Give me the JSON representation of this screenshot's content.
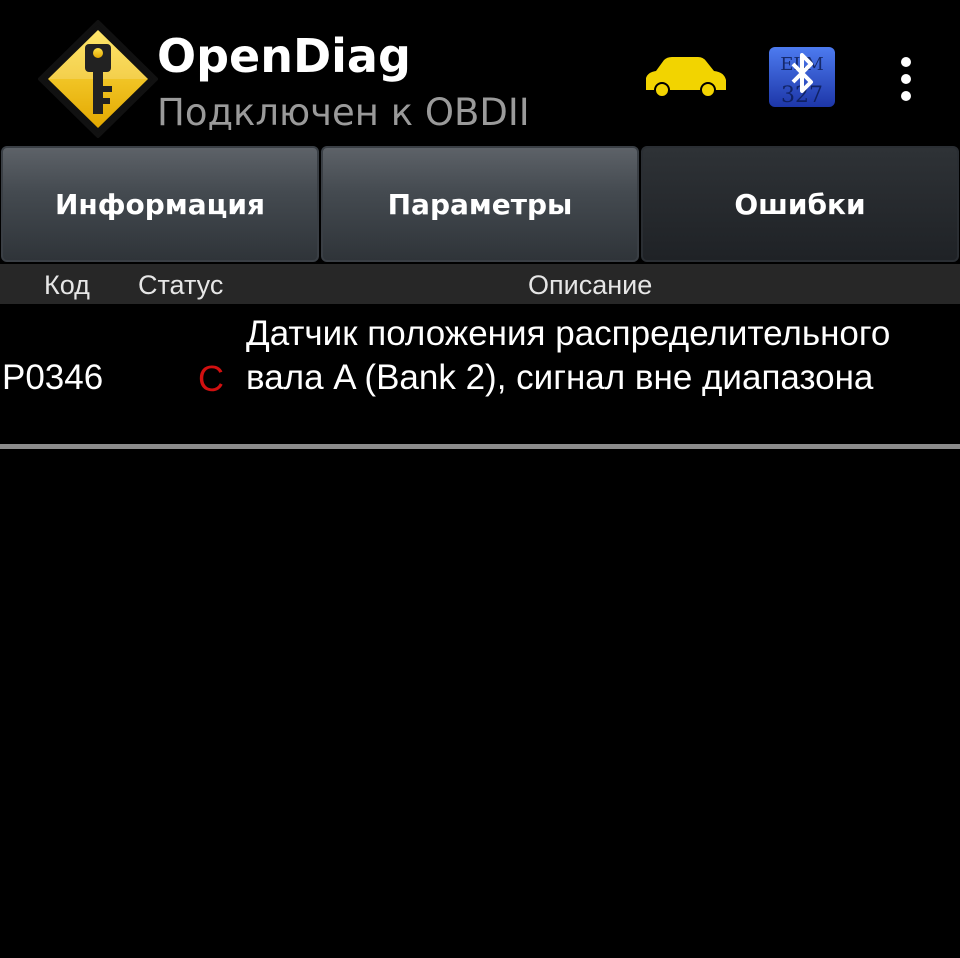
{
  "header": {
    "title": "OpenDiag",
    "subtitle": "Подключен к OBDII",
    "logo_icon": "key-warning-sign-icon",
    "car_icon": "car-icon",
    "adapter_icon": "elm327-bluetooth-icon",
    "menu_icon": "overflow-menu-icon",
    "adapter_logo_text": "ELM 327"
  },
  "tabs": [
    {
      "label": "Информация",
      "active": false
    },
    {
      "label": "Параметры",
      "active": false
    },
    {
      "label": "Ошибки",
      "active": true
    }
  ],
  "table": {
    "columns": [
      "Код",
      "Статус",
      "Описание"
    ],
    "rows": [
      {
        "code": "P0346",
        "status": "C",
        "description": "Датчик положения распределительного вала A (Bank 2), сигнал вне диапазона"
      }
    ]
  },
  "colors": {
    "background": "#000000",
    "status_error": "#d11010",
    "car": "#f2d400",
    "logo_yellow": "#f4c400",
    "adapter_blue": "#3050c8"
  }
}
